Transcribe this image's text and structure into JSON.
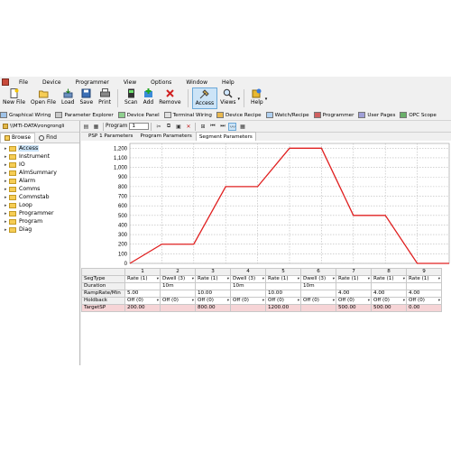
{
  "menu": [
    "File",
    "Device",
    "Programmer",
    "View",
    "Options",
    "Window",
    "Help"
  ],
  "toolbar": {
    "buttons": [
      {
        "label": "New File",
        "icon": "new-file-icon"
      },
      {
        "label": "Open File",
        "icon": "open-file-icon"
      },
      {
        "label": "Load",
        "icon": "load-icon"
      },
      {
        "label": "Save",
        "icon": "save-icon"
      },
      {
        "label": "Print",
        "icon": "print-icon"
      },
      {
        "label": "Scan",
        "icon": "scan-icon"
      },
      {
        "label": "Add",
        "icon": "add-icon"
      },
      {
        "label": "Remove",
        "icon": "remove-icon"
      },
      {
        "label": "Access",
        "icon": "access-icon"
      },
      {
        "label": "Views",
        "icon": "views-icon"
      },
      {
        "label": "Help",
        "icon": "help-icon"
      }
    ]
  },
  "viewbar": [
    "Graphical Wiring",
    "Parameter Explorer",
    "Device Panel",
    "Terminal Wiring",
    "Device Recipe",
    "Watch/Recipe",
    "Programmer",
    "User Pages",
    "OPC Scope"
  ],
  "left": {
    "path": "\\\\MTI-DATA\\rongrongli",
    "tabs": [
      "Browse",
      "Find"
    ],
    "tree": [
      {
        "label": "Access",
        "selected": true
      },
      {
        "label": "Instrument"
      },
      {
        "label": "IO"
      },
      {
        "label": "AlmSummary"
      },
      {
        "label": "Alarm"
      },
      {
        "label": "Comms"
      },
      {
        "label": "Commstab"
      },
      {
        "label": "Loop"
      },
      {
        "label": "Programmer"
      },
      {
        "label": "Program"
      },
      {
        "label": "Diag"
      }
    ]
  },
  "right": {
    "program_label": "Program",
    "program_value": "1",
    "tabs": [
      "PSP 1 Parameters",
      "Program Parameters",
      "Segment Parameters"
    ],
    "selected_tab": 2
  },
  "chart_data": {
    "type": "line",
    "y_ticks": [
      0,
      100,
      200,
      300,
      400,
      500,
      600,
      700,
      800,
      900,
      1000,
      1100,
      1200
    ],
    "ylim": [
      0,
      1250
    ],
    "xlim": [
      0,
      100
    ],
    "series": [
      {
        "color": "#e02020",
        "x": [
          0,
          10,
          20,
          30,
          40,
          50,
          60,
          70,
          80,
          90,
          100
        ],
        "values": [
          0,
          200,
          200,
          800,
          800,
          1200,
          1200,
          500,
          500,
          0,
          0
        ]
      }
    ],
    "grid": true,
    "line_color": "#e02020"
  },
  "grid": {
    "columns": [
      "1",
      "2",
      "3",
      "4",
      "5",
      "6",
      "7",
      "8",
      "9"
    ],
    "rows": [
      {
        "label": "SegType",
        "cells": [
          "Rate (1)",
          "Dwell (3)",
          "Rate (1)",
          "Dwell (3)",
          "Rate (1)",
          "Dwell (3)",
          "Rate (1)",
          "Rate (1)",
          "Rate (1)"
        ]
      },
      {
        "label": "Duration",
        "cells": [
          "",
          "10m",
          "",
          "10m",
          "",
          "10m",
          "",
          "",
          ""
        ]
      },
      {
        "label": "RampRate/Min",
        "cells": [
          "5.00",
          "",
          "10.00",
          "",
          "10.00",
          "",
          "4.00",
          "4.00",
          "4.00"
        ]
      },
      {
        "label": "Holdback",
        "cells": [
          "Off (0)",
          "Off (0)",
          "Off (0)",
          "Off (0)",
          "Off (0)",
          "Off (0)",
          "Off (0)",
          "Off (0)",
          "Off (0)"
        ]
      },
      {
        "label": "TargetSP",
        "cells": [
          "200.00",
          "",
          "800.00",
          "",
          "1200.00",
          "",
          "500.00",
          "500.00",
          "0.00"
        ]
      }
    ]
  }
}
